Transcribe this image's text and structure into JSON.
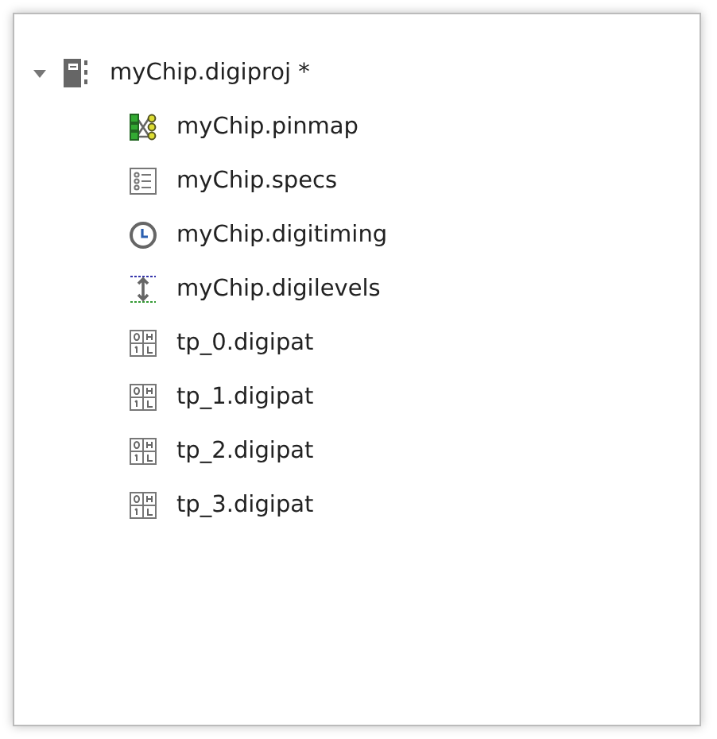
{
  "tree": {
    "label": "myChip.digiproj *",
    "expanded": true,
    "children": [
      {
        "label": "myChip.pinmap",
        "kind": "pinmap"
      },
      {
        "label": "myChip.specs",
        "kind": "specs"
      },
      {
        "label": "myChip.digitiming",
        "kind": "timing"
      },
      {
        "label": "myChip.digilevels",
        "kind": "levels"
      },
      {
        "label": "tp_0.digipat",
        "kind": "pattern"
      },
      {
        "label": "tp_1.digipat",
        "kind": "pattern"
      },
      {
        "label": "tp_2.digipat",
        "kind": "pattern"
      },
      {
        "label": "tp_3.digipat",
        "kind": "pattern"
      }
    ]
  }
}
